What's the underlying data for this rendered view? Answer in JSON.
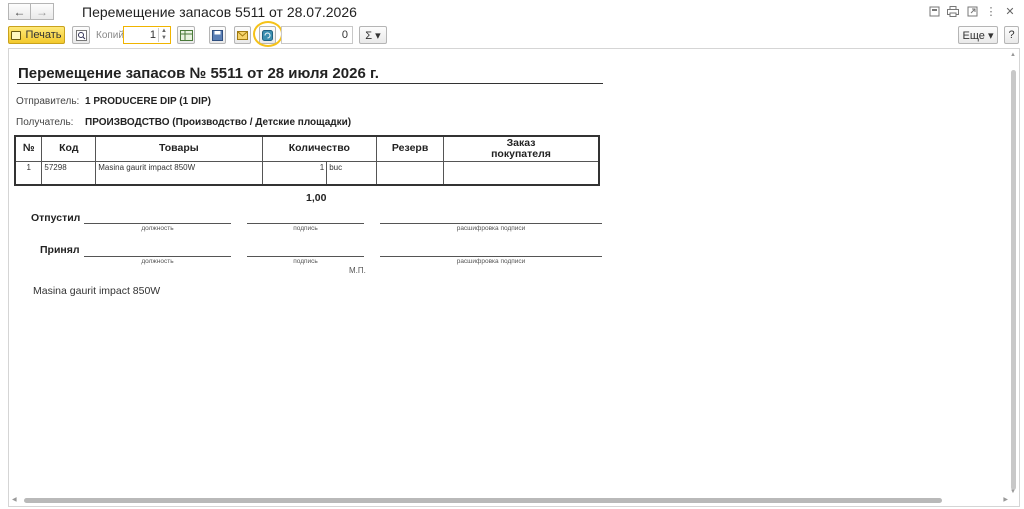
{
  "window": {
    "title": "Перемещение запасов 5511 от 28.07.2026"
  },
  "toolbar": {
    "print_label": "Печать",
    "copies_label": "Копий",
    "copies_value": "1",
    "sum_value": "0",
    "sigma_label": "Σ ▾",
    "more_label": "Еще ▾",
    "help_label": "?"
  },
  "document": {
    "title": "Перемещение запасов № 5511 от 28 июля 2026 г.",
    "sender_label": "Отправитель:",
    "sender_value": "1 PRODUCERE DIP (1 DIP)",
    "recipient_label": "Получатель:",
    "recipient_value": "ПРОИЗВОДСТВО (Производство / Детские площадки)",
    "table": {
      "headers": [
        "№",
        "Код",
        "Товары",
        "Количество",
        "Резерв",
        "Заказ покупателя"
      ],
      "header_order_line1": "Заказ",
      "header_order_line2": "покупателя",
      "rows": [
        {
          "num": "1",
          "code": "57298",
          "goods": "Masina gaurit impact 850W",
          "qty": "1",
          "unit": "buc",
          "reserve": "",
          "order": ""
        }
      ]
    },
    "total": "1,00",
    "released_label": "Отпустил",
    "received_label": "Принял",
    "caption_position": "должность",
    "caption_signature": "подпись",
    "caption_decoding": "расшифровка подписи",
    "stamp_label": "М.П.",
    "note": "Masina gaurit impact 850W"
  },
  "colors": {
    "print_button": "#f3c92d",
    "highlight_ring": "#f5c218",
    "copies_border": "#f0b400"
  }
}
